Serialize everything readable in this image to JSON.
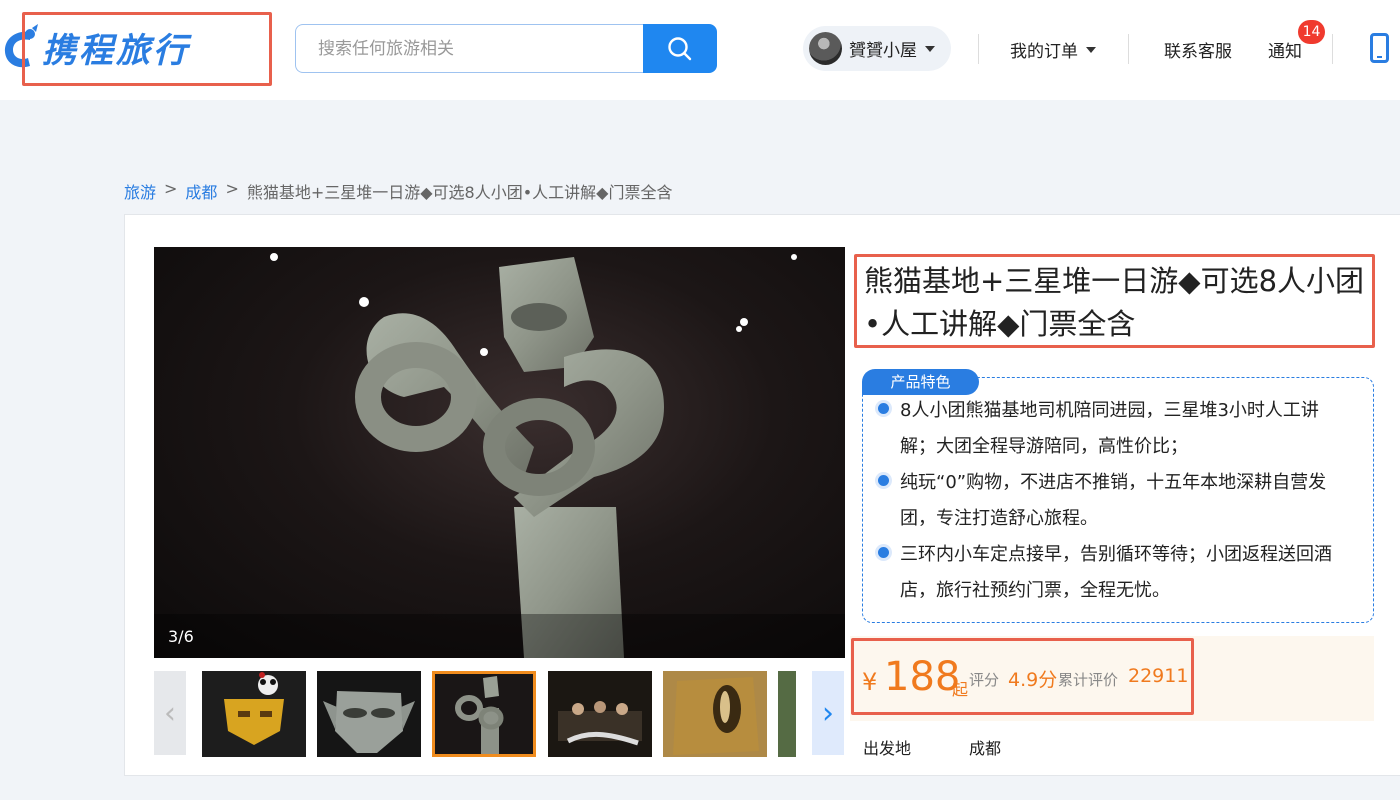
{
  "colors": {
    "brand": "#2a7de1",
    "accent": "#f07a1e",
    "highlight_border": "#e8604c",
    "badge": "#f03a2e"
  },
  "header": {
    "logo_text": "携程旅行",
    "search": {
      "placeholder": "搜索任何旅游相关",
      "value": ""
    },
    "user_name": "贇贇小屋",
    "nav": {
      "orders": "我的订单",
      "customer_service": "联系客服",
      "notifications": "通知",
      "notification_count": "14"
    }
  },
  "breadcrumb": [
    {
      "label": "旅游"
    },
    {
      "label": "成都"
    },
    {
      "label": "熊猫基地+三星堆一日游◆可选8人小团•人工讲解◆门票全含"
    }
  ],
  "breadcrumb_sep": ">",
  "gallery": {
    "counter": "3/6"
  },
  "product": {
    "title": "熊猫基地+三星堆一日游◆可选8人小团•人工讲解◆门票全含",
    "features_tag": "产品特色",
    "features": [
      "8人小团熊猫基地司机陪同进园，三星堆3小时人工讲解；大团全程导游陪同，高性价比；",
      "纯玩“0”购物，不进店不推销，十五年本地深耕自营发团，专注打造舒心旅程。",
      "三环内小车定点接早，告别循环等待；小团返程送回酒店，旅行社预约门票，全程无忧。"
    ],
    "price": {
      "currency": "¥",
      "amount": "188",
      "suffix": "起"
    },
    "rating": {
      "label": "评分",
      "value": "4.9分"
    },
    "reviews": {
      "label": "累计评价",
      "value": "22911"
    },
    "departure": {
      "label": "出发地",
      "value": "成都"
    }
  }
}
